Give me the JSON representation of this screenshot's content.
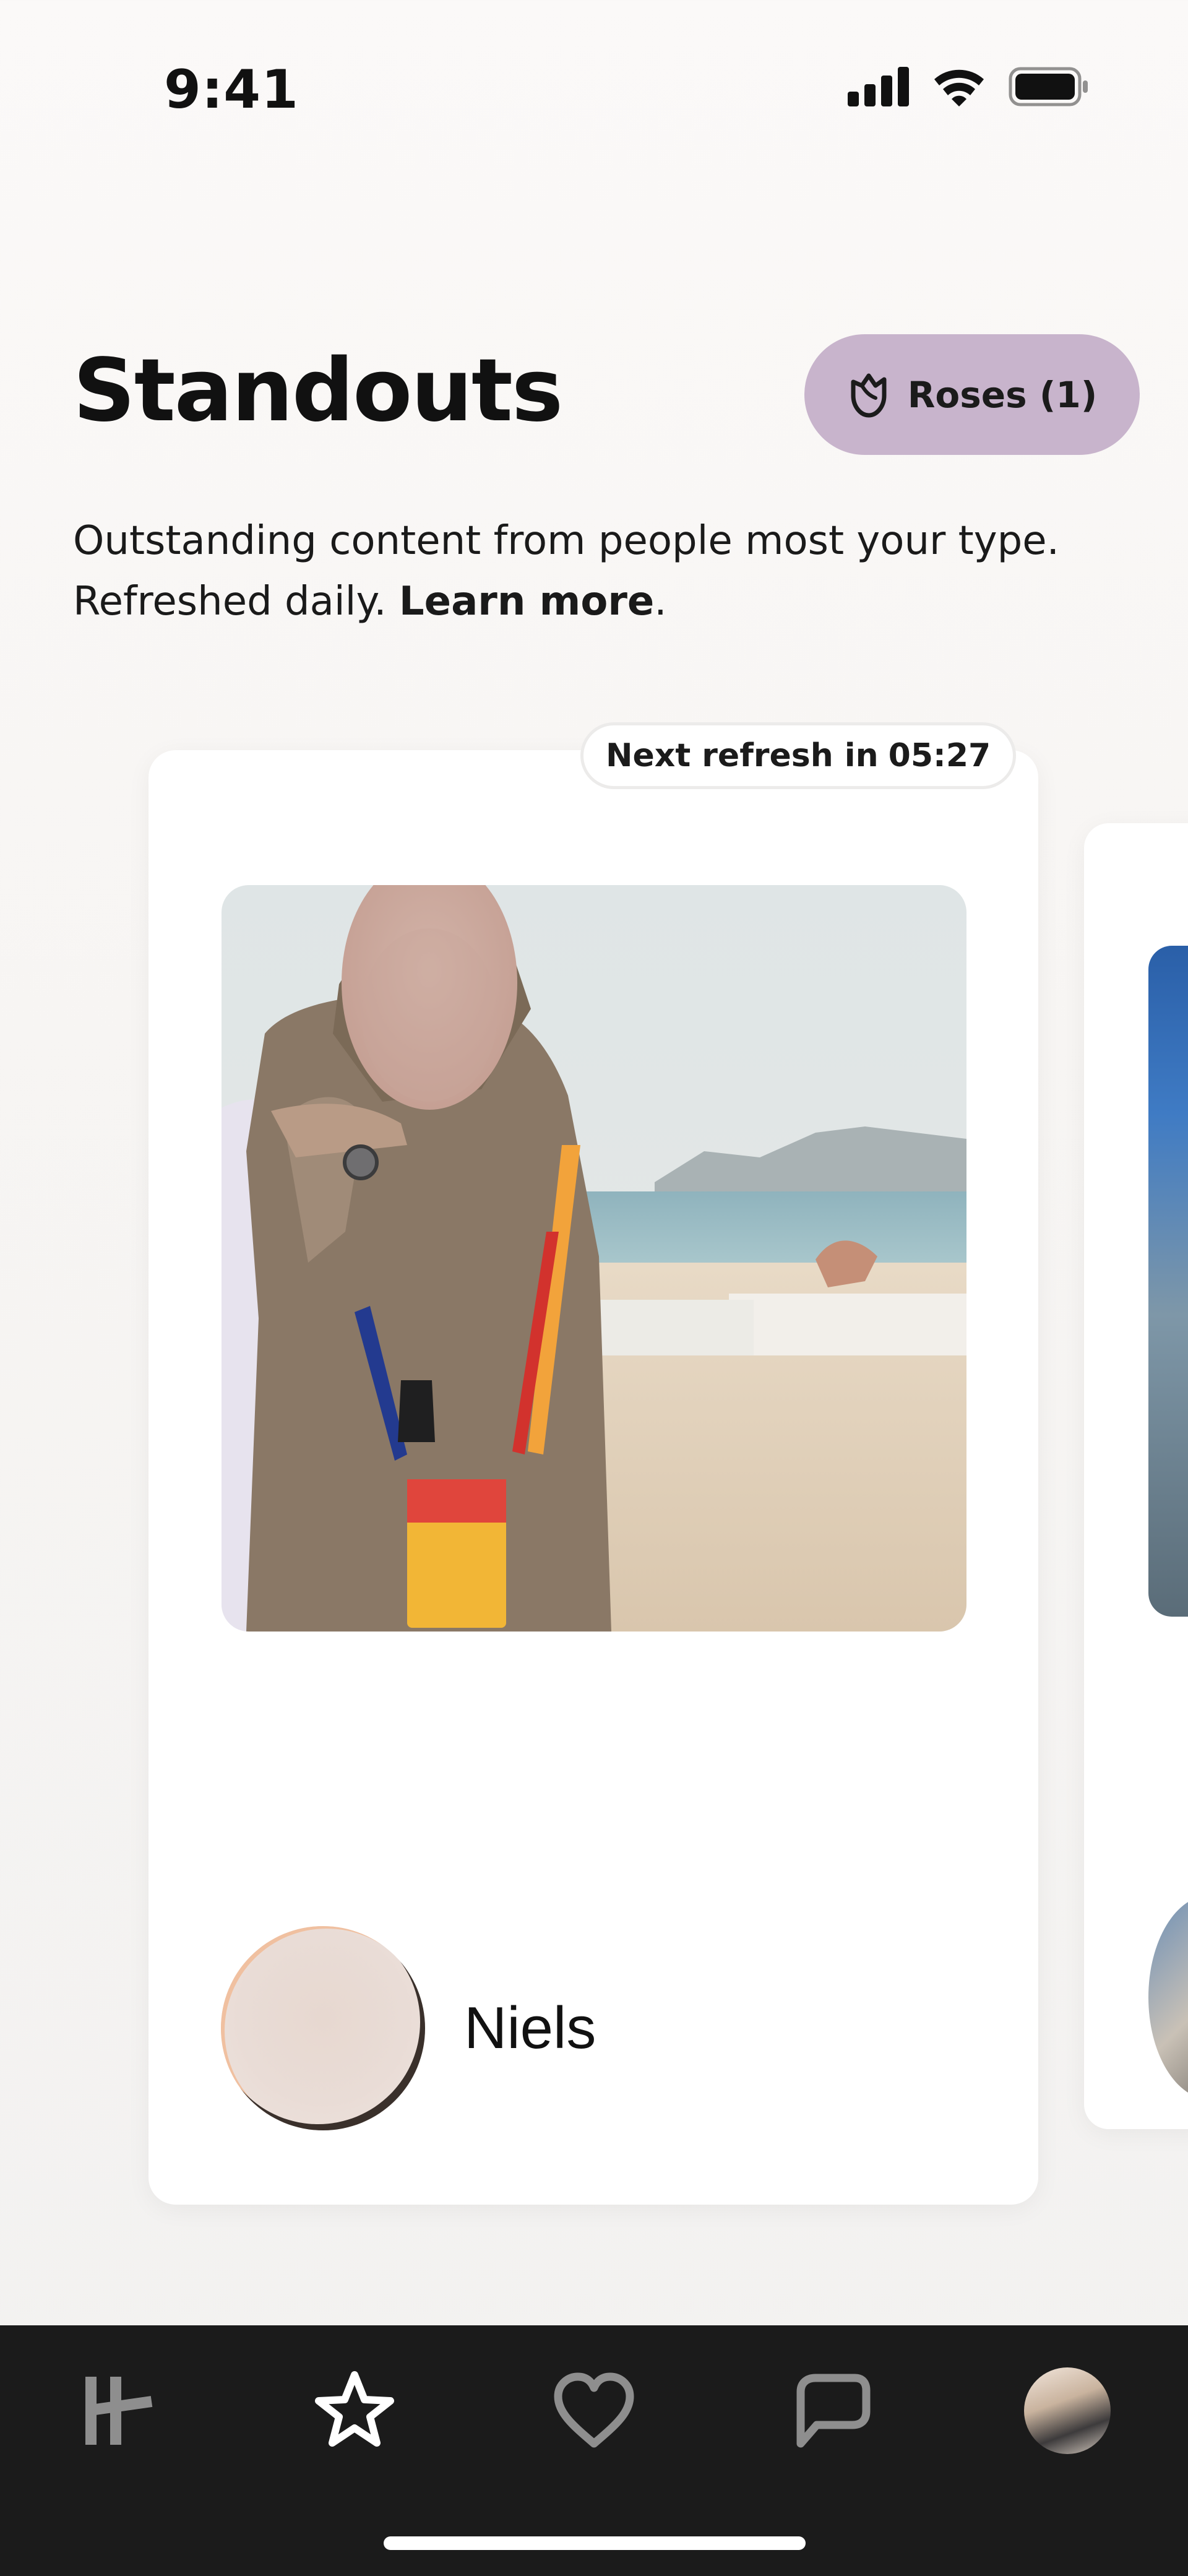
{
  "status_bar": {
    "time": "9:41"
  },
  "header": {
    "title": "Standouts",
    "roses_label": "Roses (1)"
  },
  "subtitle": {
    "text": "Outstanding content from people most your type. Refreshed daily. ",
    "link": "Learn more",
    "end": "."
  },
  "card": {
    "refresh_label": "Next refresh in",
    "refresh_time": "05:27",
    "name": "Niels"
  },
  "tabs": [
    "hinge-logo-icon",
    "star-icon",
    "heart-icon",
    "chat-icon",
    "profile-avatar"
  ],
  "colors": {
    "roses_bg": "#c8b4cc",
    "tabbar_bg": "#1b1b1b",
    "accent": "#ffffff"
  }
}
